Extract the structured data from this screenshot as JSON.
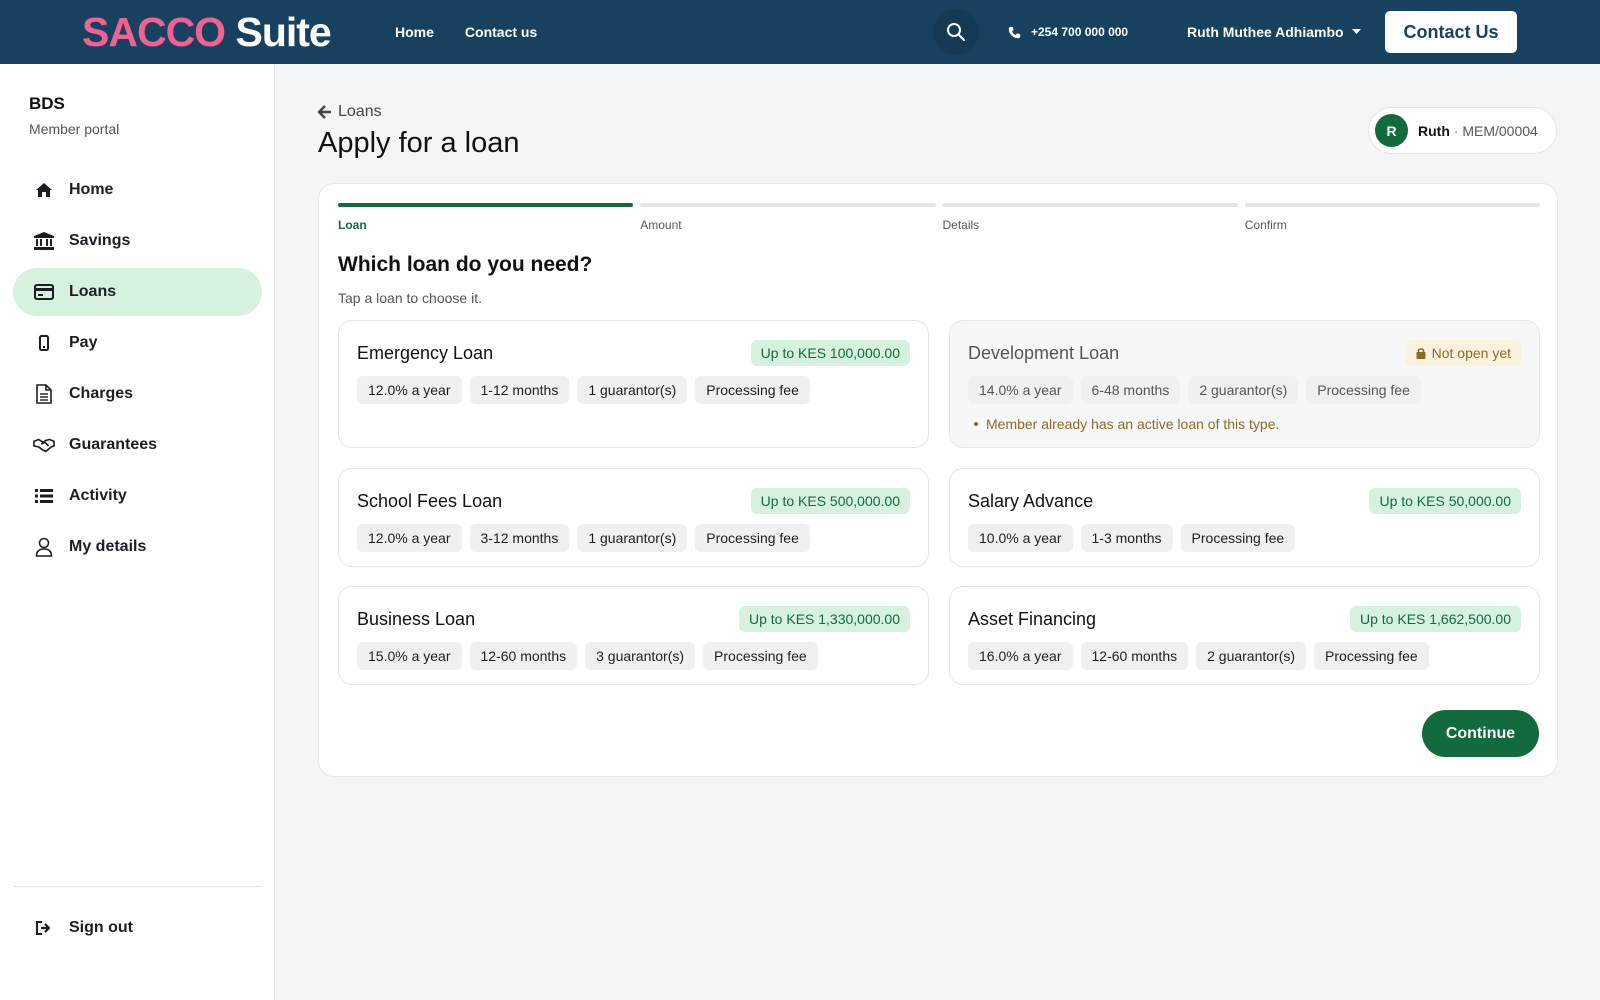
{
  "brand": {
    "part1": "SACCO",
    "part2": "Suite"
  },
  "topnav": {
    "home": "Home",
    "contact": "Contact us"
  },
  "header": {
    "search_icon": "search-icon",
    "phone": "+254 700 000 000",
    "user_name": "Ruth Muthee Adhiambo",
    "contact_button": "Contact Us"
  },
  "sidebar": {
    "org": "BDS",
    "org_sub": "Member portal",
    "items": [
      {
        "label": "Home",
        "icon": "home-icon"
      },
      {
        "label": "Savings",
        "icon": "bank-icon"
      },
      {
        "label": "Loans",
        "icon": "credit-card-icon"
      },
      {
        "label": "Pay",
        "icon": "mobile-phone-icon"
      },
      {
        "label": "Charges",
        "icon": "document-icon"
      },
      {
        "label": "Guarantees",
        "icon": "handshake-icon"
      },
      {
        "label": "Activity",
        "icon": "list-icon"
      },
      {
        "label": "My details",
        "icon": "user-icon"
      }
    ],
    "active_index": 2,
    "signout": "Sign out"
  },
  "page": {
    "back_label": "Loans",
    "title": "Apply for a loan",
    "member": {
      "initial": "R",
      "name": "Ruth",
      "separator": "·",
      "id": "MEM/00004"
    }
  },
  "wizard": {
    "steps": [
      "Loan",
      "Amount",
      "Details",
      "Confirm"
    ],
    "active_step": 0,
    "question": "Which loan do you need?",
    "hint": "Tap a loan to choose it.",
    "continue": "Continue"
  },
  "loans": [
    {
      "name": "Emergency Loan",
      "limit": "Up to KES 100,000.00",
      "tags": [
        "12.0% a year",
        "1-12 months",
        "1 guarantor(s)",
        "Processing fee"
      ]
    },
    {
      "name": "Development Loan",
      "status": "Not open yet",
      "tags": [
        "14.0% a year",
        "6-48 months",
        "2 guarantor(s)",
        "Processing fee"
      ],
      "note": "Member already has an active loan of this type.",
      "disabled": true
    },
    {
      "name": "School Fees Loan",
      "limit": "Up to KES 500,000.00",
      "tags": [
        "12.0% a year",
        "3-12 months",
        "1 guarantor(s)",
        "Processing fee"
      ]
    },
    {
      "name": "Salary Advance",
      "limit": "Up to KES 50,000.00",
      "tags": [
        "10.0% a year",
        "1-3 months",
        "Processing fee"
      ]
    },
    {
      "name": "Business Loan",
      "limit": "Up to KES 1,330,000.00",
      "tags": [
        "15.0% a year",
        "12-60 months",
        "3 guarantor(s)",
        "Processing fee"
      ]
    },
    {
      "name": "Asset Financing",
      "limit": "Up to KES 1,662,500.00",
      "tags": [
        "16.0% a year",
        "12-60 months",
        "2 guarantor(s)",
        "Processing fee"
      ]
    }
  ],
  "colors": {
    "header": "#17415f",
    "accent": "#116b3d",
    "brand_pink": "#f06292"
  }
}
